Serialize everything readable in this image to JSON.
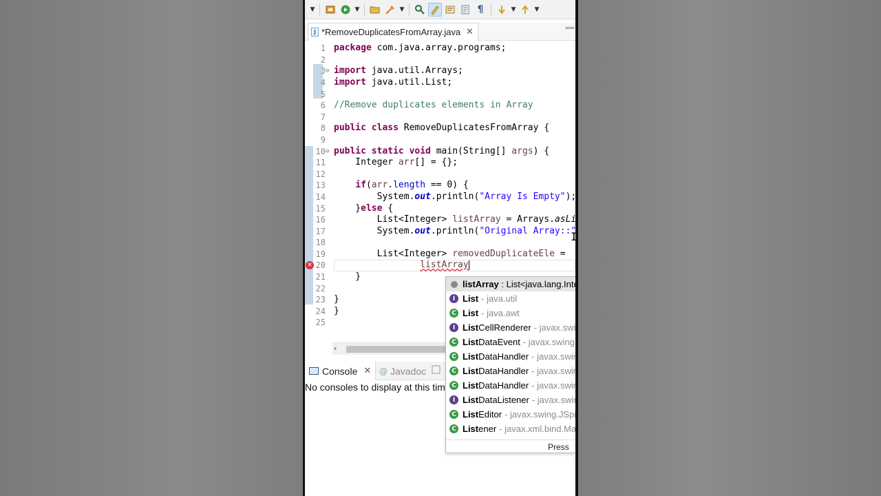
{
  "toolbar": {
    "icons": [
      "package-explorer-icon",
      "run-icon",
      "open-folder-icon",
      "debug-icon",
      "open-type-icon",
      "highlight-icon",
      "toggle-block-icon",
      "show-whitespace-icon",
      "pilcrow-icon",
      "next-annotation-icon",
      "previous-annotation-icon"
    ]
  },
  "editor": {
    "tab_title": "*RemoveDuplicatesFromArray.java",
    "tab_icon": "J",
    "lines": [
      {
        "n": "1",
        "text": "package com.java.array.programs;"
      },
      {
        "n": "2",
        "text": ""
      },
      {
        "n": "3",
        "text": "import java.util.Arrays;"
      },
      {
        "n": "4",
        "text": "import java.util.List;"
      },
      {
        "n": "5",
        "text": ""
      },
      {
        "n": "6",
        "text": "//Remove duplicates elements in Array"
      },
      {
        "n": "7",
        "text": ""
      },
      {
        "n": "8",
        "text": "public class RemoveDuplicatesFromArray {"
      },
      {
        "n": "9",
        "text": ""
      },
      {
        "n": "10",
        "text": "public static void main(String[] args) {"
      },
      {
        "n": "11",
        "text": "    Integer arr[] = {};"
      },
      {
        "n": "12",
        "text": ""
      },
      {
        "n": "13",
        "text": "    if(arr.length == 0) {"
      },
      {
        "n": "14",
        "text": "        System.out.println(\"Array Is Empty\");"
      },
      {
        "n": "15",
        "text": "    }else {"
      },
      {
        "n": "16",
        "text": "        List<Integer> listArray = Arrays.asLi"
      },
      {
        "n": "17",
        "text": "        System.out.println(\"Original Array::\""
      },
      {
        "n": "18",
        "text": ""
      },
      {
        "n": "19",
        "text": "        List<Integer> removedDuplicateEle ="
      },
      {
        "n": "20",
        "text": "                listArray"
      },
      {
        "n": "21",
        "text": "    }"
      },
      {
        "n": "22",
        "text": ""
      },
      {
        "n": "23",
        "text": "}"
      },
      {
        "n": "24",
        "text": "}"
      },
      {
        "n": "25",
        "text": ""
      }
    ]
  },
  "console": {
    "tab_label": "Console",
    "javadoc_label": "Javadoc",
    "message": "No consoles to display at this time."
  },
  "content_assist": {
    "items": [
      {
        "name": "listArray",
        "bold": "listArray",
        "rest": " : List<java.lang.Inte",
        "pkg": "",
        "kind": "local"
      },
      {
        "name": "List",
        "bold": "List",
        "rest": "",
        "pkg": "- java.util",
        "kind": "interface"
      },
      {
        "name": "List",
        "bold": "List",
        "rest": "",
        "pkg": "- java.awt",
        "kind": "class"
      },
      {
        "name": "ListCellRenderer",
        "bold": "List",
        "rest": "CellRenderer",
        "pkg": "- javax.swin",
        "kind": "interface"
      },
      {
        "name": "ListDataEvent",
        "bold": "List",
        "rest": "DataEvent",
        "pkg": "- javax.swing.",
        "kind": "class"
      },
      {
        "name": "ListDataHandler",
        "bold": "List",
        "rest": "DataHandler",
        "pkg": "- javax.swin",
        "kind": "class"
      },
      {
        "name": "ListDataHandler",
        "bold": "List",
        "rest": "DataHandler",
        "pkg": "- javax.swin",
        "kind": "class"
      },
      {
        "name": "ListDataHandler",
        "bold": "List",
        "rest": "DataHandler",
        "pkg": "- javax.swin",
        "kind": "class"
      },
      {
        "name": "ListDataListener",
        "bold": "List",
        "rest": "DataListener",
        "pkg": "- javax.swin",
        "kind": "interface"
      },
      {
        "name": "ListEditor",
        "bold": "List",
        "rest": "Editor",
        "pkg": "- javax.swing.JSpin",
        "kind": "class"
      },
      {
        "name": "Listener",
        "bold": "List",
        "rest": "ener",
        "pkg": "- javax.xml.bind.Ma",
        "kind": "class"
      }
    ],
    "footer": "Press 'C"
  }
}
